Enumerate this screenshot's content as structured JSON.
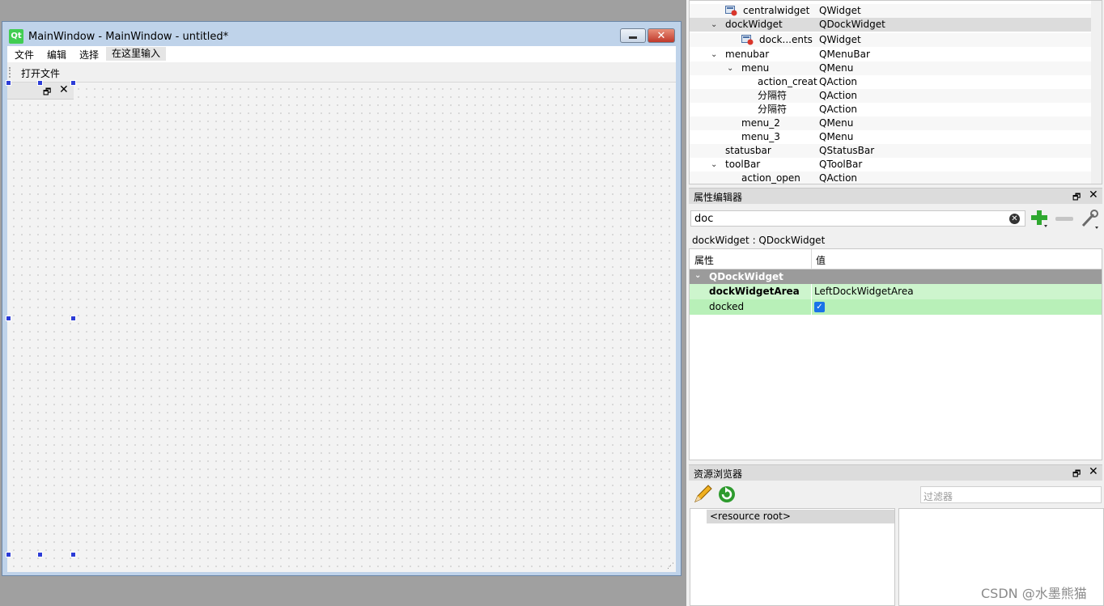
{
  "form_window": {
    "logo": "Qt",
    "title": "MainWindow - MainWindow - untitled*",
    "minimize_icon": "minimize-icon",
    "close_glyph": "✕",
    "menubar": {
      "items": [
        "文件",
        "编辑",
        "选择"
      ],
      "type_here": "在这里输入"
    },
    "toolbar": {
      "open_action": "打开文件"
    },
    "dock": {
      "float_glyph": "🗗",
      "close_glyph": "✕"
    },
    "resize_glyph": "⋰"
  },
  "object_inspector": {
    "rows": [
      {
        "name": "centralwidget",
        "class": "QWidget",
        "arrow": "",
        "icon": "widget-icon"
      },
      {
        "name": "dockWidget",
        "class": "QDockWidget",
        "arrow": "⌄",
        "icon": ""
      },
      {
        "name": "dock...ents",
        "class": "QWidget",
        "arrow": "",
        "icon": "widget-icon"
      },
      {
        "name": "menubar",
        "class": "QMenuBar",
        "arrow": "⌄",
        "icon": ""
      },
      {
        "name": "menu",
        "class": "QMenu",
        "arrow": "⌄",
        "icon": ""
      },
      {
        "name": "action_creat",
        "class": "QAction",
        "arrow": "",
        "icon": ""
      },
      {
        "name": "分隔符",
        "class": "QAction",
        "arrow": "",
        "icon": ""
      },
      {
        "name": "分隔符",
        "class": "QAction",
        "arrow": "",
        "icon": ""
      },
      {
        "name": "menu_2",
        "class": "QMenu",
        "arrow": "",
        "icon": ""
      },
      {
        "name": "menu_3",
        "class": "QMenu",
        "arrow": "",
        "icon": ""
      },
      {
        "name": "statusbar",
        "class": "QStatusBar",
        "arrow": "",
        "icon": ""
      },
      {
        "name": "toolBar",
        "class": "QToolBar",
        "arrow": "⌄",
        "icon": ""
      },
      {
        "name": "action_open",
        "class": "QAction",
        "arrow": "",
        "icon": ""
      }
    ]
  },
  "property_editor": {
    "title": "属性编辑器",
    "float_glyph": "🗗",
    "close_glyph": "✕",
    "filter_value": "doc",
    "clear_glyph": "✕",
    "object_label": "dockWidget : QDockWidget",
    "col_property": "属性",
    "col_value": "值",
    "group": "QDockWidget",
    "group_arrow": "⌄",
    "rows": [
      {
        "name": "dockWidgetArea",
        "value": "LeftDockWidgetArea"
      },
      {
        "name": "docked",
        "value": "",
        "checked": true
      }
    ],
    "check_glyph": "✓"
  },
  "resource_browser": {
    "title": "资源浏览器",
    "float_glyph": "🗗",
    "close_glyph": "✕",
    "filter_placeholder": "过滤器",
    "root": "<resource root>"
  },
  "watermark": "CSDN @水墨熊猫",
  "colors": {
    "title_bar": "#bfd3ea",
    "group_header": "#9b9b9b",
    "changed_property": "#cdf5cd",
    "checkbox": "#1a73e8",
    "selection_handle": "#2c3cd6"
  }
}
